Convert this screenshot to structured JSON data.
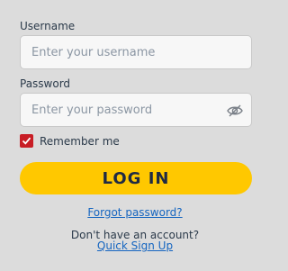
{
  "username": {
    "label": "Username",
    "placeholder": "Enter your username",
    "value": ""
  },
  "password": {
    "label": "Password",
    "placeholder": "Enter your password",
    "value": "",
    "toggle_icon": "eye-slash-icon"
  },
  "remember": {
    "label": "Remember me",
    "checked": true,
    "icon": "checkmark-icon"
  },
  "login_button": {
    "label": "LOG IN"
  },
  "forgot_link": {
    "label": "Forgot password?"
  },
  "signup": {
    "prompt": "Don't have an account?",
    "link_label": "Quick Sign Up"
  },
  "colors": {
    "background": "#dcdcdc",
    "accent_button": "#ffc800",
    "checkbox": "#c81d25",
    "link": "#1565c0",
    "text": "#2b3a4a"
  }
}
